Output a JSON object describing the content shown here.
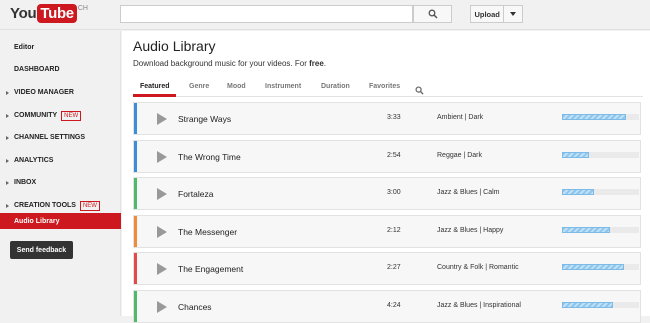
{
  "header": {
    "logo_you": "You",
    "logo_tube": "Tube",
    "logo_region": "CH",
    "search_placeholder": "",
    "upload_label": "Upload"
  },
  "sidebar": {
    "items": [
      {
        "label": "Editor",
        "arrow": false,
        "badge": ""
      },
      {
        "label": "DASHBOARD",
        "arrow": false,
        "badge": ""
      },
      {
        "label": "VIDEO MANAGER",
        "arrow": true,
        "badge": ""
      },
      {
        "label": "COMMUNITY",
        "arrow": true,
        "badge": "NEW"
      },
      {
        "label": "CHANNEL SETTINGS",
        "arrow": true,
        "badge": ""
      },
      {
        "label": "ANALYTICS",
        "arrow": true,
        "badge": ""
      },
      {
        "label": "INBOX",
        "arrow": true,
        "badge": ""
      },
      {
        "label": "CREATION TOOLS",
        "arrow": true,
        "badge": "NEW"
      }
    ],
    "active_item": "Audio Library",
    "feedback_label": "Send feedback"
  },
  "main": {
    "title": "Audio Library",
    "subtitle": "Download background music for your videos. For ",
    "subtitle_bold": "free",
    "subtitle_end": ".",
    "tabs": [
      "Featured",
      "Genre",
      "Mood",
      "Instrument",
      "Duration",
      "Favorites"
    ],
    "active_tab": "Featured"
  },
  "tracks": [
    {
      "title": "Strange Ways",
      "duration": "3:33",
      "genre": "Ambient | Dark",
      "color": "#3b8fd6",
      "popularity": 0.83
    },
    {
      "title": "The Wrong Time",
      "duration": "2:54",
      "genre": "Reggae | Dark",
      "color": "#3b8fd6",
      "popularity": 0.35
    },
    {
      "title": "Fortaleza",
      "duration": "3:00",
      "genre": "Jazz & Blues | Calm",
      "color": "#4dbb6a",
      "popularity": 0.42
    },
    {
      "title": "The Messenger",
      "duration": "2:12",
      "genre": "Jazz & Blues | Happy",
      "color": "#ef8b3a",
      "popularity": 0.62
    },
    {
      "title": "The Engagement",
      "duration": "2:27",
      "genre": "Country & Folk | Romantic",
      "color": "#e24b4b",
      "popularity": 0.8
    },
    {
      "title": "Chances",
      "duration": "4:24",
      "genre": "Jazz & Blues | Inspirational",
      "color": "#4dbb6a",
      "popularity": 0.66
    }
  ]
}
